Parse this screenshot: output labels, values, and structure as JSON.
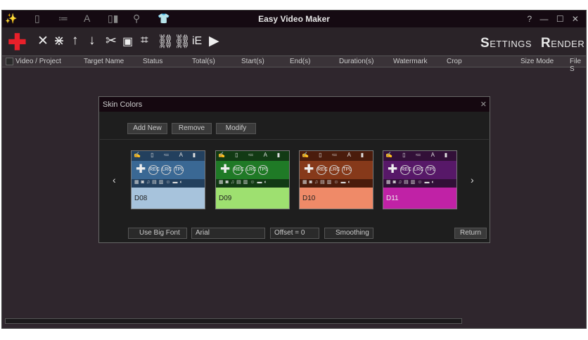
{
  "window": {
    "title": "Easy Video Maker",
    "controls": "? — ☐ ✕"
  },
  "toolbar": {
    "settings_first": "S",
    "settings_rest": "ETTINGS",
    "render_first": "R",
    "render_rest": "ENDER"
  },
  "columns": [
    "Video / Project",
    "Target Name",
    "Status",
    "Total(s)",
    "Start(s)",
    "End(s)",
    "Duration(s)",
    "Watermark",
    "Crop",
    "Size Mode",
    "File S"
  ],
  "dialog": {
    "title": "Skin Colors",
    "close": "✕",
    "add_new": "Add New",
    "remove": "Remove",
    "modify": "Modify",
    "skins": [
      {
        "label": "D08",
        "head": "#23405e",
        "mid": "#3a6894",
        "low": "#a7c3dc",
        "text": "#222"
      },
      {
        "label": "D09",
        "head": "#123a14",
        "mid": "#1f7a26",
        "low": "#9ee070",
        "text": "#222"
      },
      {
        "label": "D10",
        "head": "#4a1c0c",
        "mid": "#86391a",
        "low": "#ef8a68",
        "text": "#222"
      },
      {
        "label": "D11",
        "head": "#321038",
        "mid": "#571868",
        "low": "#c022a6",
        "text": "#eee"
      }
    ],
    "prev": "‹",
    "next": "›",
    "use_big_font": "Use Big Font",
    "font": "Arial",
    "offset": "Offset = 0",
    "smoothing": "Smoothing",
    "return": "Return"
  }
}
